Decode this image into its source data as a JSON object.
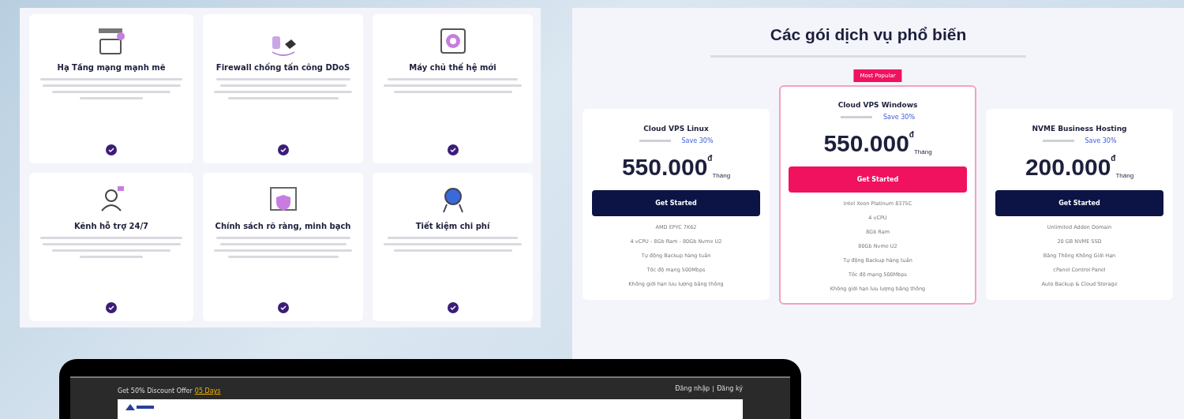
{
  "features": [
    {
      "kind": "network",
      "title": "Hạ Tầng mạng mạnh mẽ"
    },
    {
      "kind": "firewall",
      "title": "Firewall chống tấn công DDoS"
    },
    {
      "kind": "server",
      "title": "Máy chủ thế hệ mới"
    },
    {
      "kind": "support",
      "title": "Kênh hỗ trợ 24/7"
    },
    {
      "kind": "policy",
      "title": "Chính sách rõ ràng, minh bạch"
    },
    {
      "kind": "saving",
      "title": "Tiết kiệm chi phí"
    }
  ],
  "pricing": {
    "title": "Các gói dịch vụ phổ biến",
    "plans": [
      {
        "name": "Cloud VPS Linux",
        "save": "Save 30%",
        "price": "550.000",
        "currency": "đ",
        "unit": "Tháng",
        "button": "Get Started",
        "featured": false,
        "features": [
          "AMD EPYC 7K62",
          "4 vCPU - 8Gb Ram - 80Gb Nvme U2",
          "Tự động Backup hàng tuần",
          "Tốc độ mạng 500Mbps",
          "Không giới hạn lưu lượng băng thông"
        ]
      },
      {
        "name": "Cloud VPS Windows",
        "badge": "Most Popular",
        "save": "Save 30%",
        "price": "550.000",
        "currency": "đ",
        "unit": "Tháng",
        "button": "Get Started",
        "featured": true,
        "features": [
          "Intel Xeon Platinum 8375C",
          "4 vCPU",
          "8Gb Ram",
          "80Gb Nvme U2",
          "Tự động Backup hàng tuần",
          "Tốc độ mạng 500Mbps",
          "Không giới hạn lưu lượng băng thông"
        ]
      },
      {
        "name": "NVME Business Hosting",
        "save": "Save 30%",
        "price": "200.000",
        "currency": "đ",
        "unit": "Tháng",
        "button": "Get Started",
        "featured": false,
        "features": [
          "Unlimited Addon Domain",
          "20 GB NVME SSD",
          "Băng Thông Không Giới Hạn",
          "cPanel Control Panel",
          "Auto Backup & Cloud Storage"
        ]
      }
    ]
  },
  "laptop": {
    "promo": "Get 50% Discount Offer",
    "promo_link": "05 Days",
    "links": [
      "Đăng nhập",
      "Đăng ký"
    ]
  }
}
